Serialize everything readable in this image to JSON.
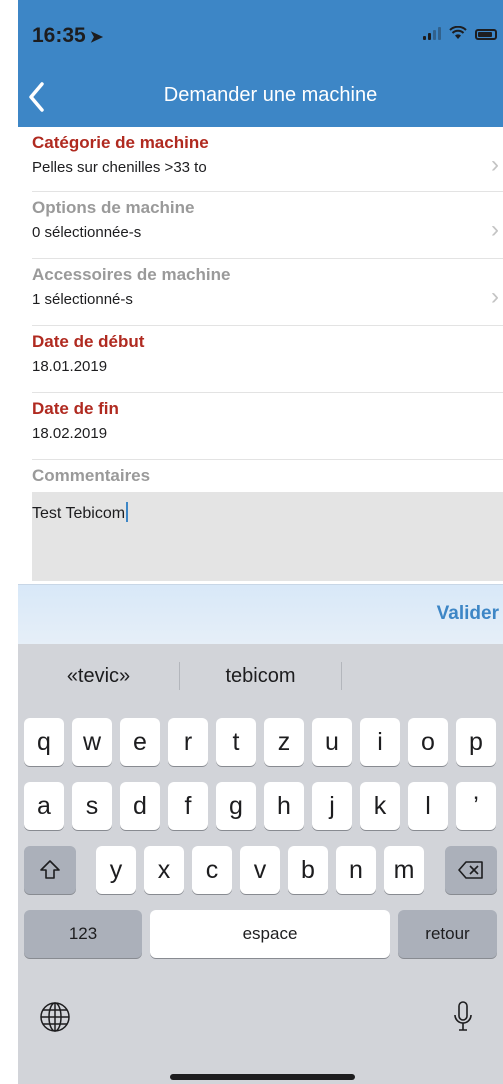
{
  "status_bar": {
    "time": "16:35"
  },
  "nav": {
    "title": "Demander une machine"
  },
  "form": {
    "categorie": {
      "label": "Catégorie de machine",
      "value": "Pelles sur chenilles >33 to"
    },
    "options": {
      "label": "Options de machine",
      "value": "0 sélectionnée-s"
    },
    "accessoires": {
      "label": "Accessoires de machine",
      "value": "1 sélectionné-s"
    },
    "date_debut": {
      "label": "Date de début",
      "value": "18.01.2019"
    },
    "date_fin": {
      "label": "Date de fin",
      "value": "18.02.2019"
    },
    "commentaires": {
      "label": "Commentaires",
      "value": "Test Tebicom"
    }
  },
  "accessory_bar": {
    "done_label": "Valider"
  },
  "keyboard": {
    "suggestions": [
      "«tevic»",
      "tebicom",
      ""
    ],
    "row1": [
      "q",
      "w",
      "e",
      "r",
      "t",
      "z",
      "u",
      "i",
      "o",
      "p"
    ],
    "row2": [
      "a",
      "s",
      "d",
      "f",
      "g",
      "h",
      "j",
      "k",
      "l",
      "’"
    ],
    "row3": [
      "y",
      "x",
      "c",
      "v",
      "b",
      "n",
      "m"
    ],
    "numbers_label": "123",
    "space_label": "espace",
    "return_label": "retour"
  },
  "icons": {
    "back": "chevron-left-icon",
    "disclosure": "chevron-right-icon",
    "shift": "shift-icon",
    "delete": "backspace-icon",
    "globe": "globe-icon",
    "mic": "microphone-icon"
  },
  "colors": {
    "nav_blue": "#3d86c6",
    "required_red": "#b02a20",
    "muted_grey": "#9a9a9a"
  }
}
